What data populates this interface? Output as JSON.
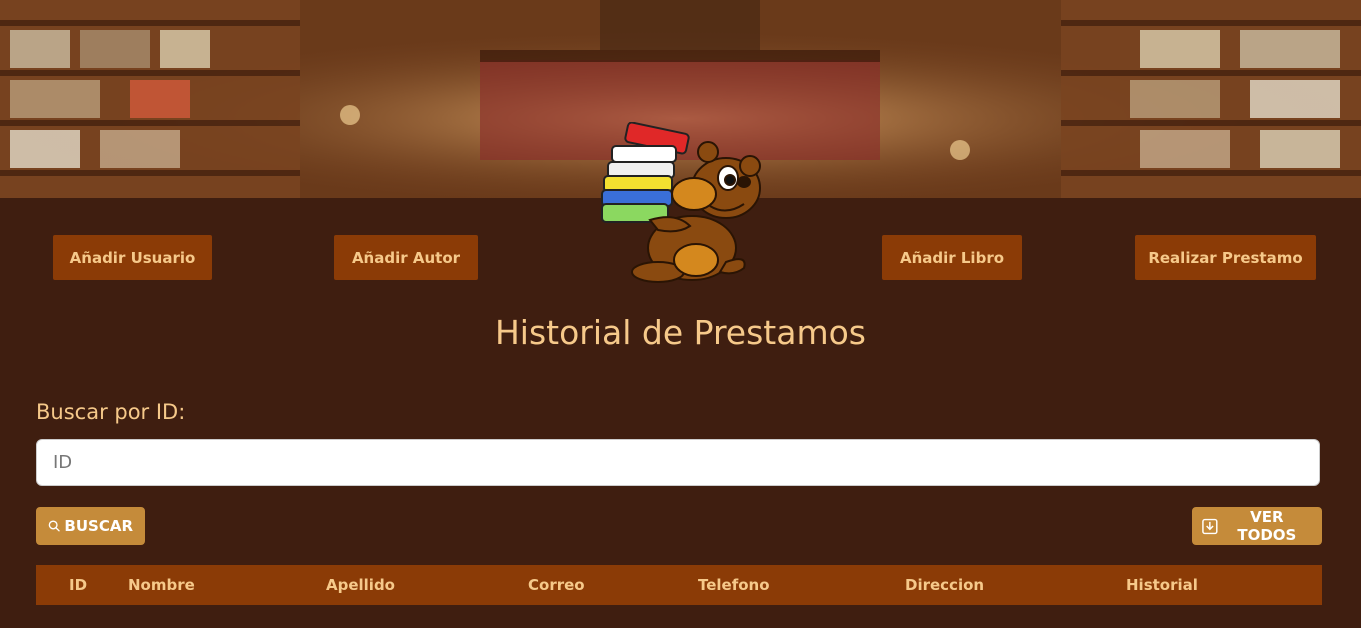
{
  "nav": {
    "add_user": "Añadir Usuario",
    "add_author": "Añadir Autor",
    "add_book": "Añadir Libro",
    "make_loan": "Realizar Prestamo"
  },
  "page_title": "Historial de Prestamos",
  "search": {
    "label": "Buscar por ID:",
    "placeholder": "ID",
    "value": "",
    "search_button": "BUSCAR",
    "view_all_button": "VER TODOS"
  },
  "table": {
    "columns": [
      "ID",
      "Nombre",
      "Apellido",
      "Correo",
      "Telefono",
      "Direccion",
      "Historial"
    ],
    "rows": []
  },
  "icons": {
    "search": "search-icon",
    "download": "download-icon",
    "mascot": "bear-with-books-logo"
  },
  "colors": {
    "background": "#3f1e10",
    "accent": "#8b3b06",
    "accent_text": "#f6c98a",
    "button": "#c58b3a"
  }
}
